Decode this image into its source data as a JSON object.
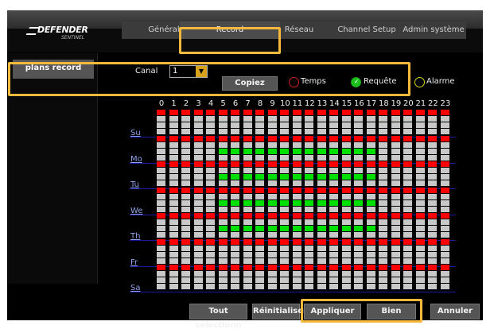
{
  "logo": {
    "brand": "DEFENDER",
    "sub": "SENTINEL"
  },
  "tabs": [
    {
      "label": "Général",
      "active": false
    },
    {
      "label": "Record",
      "active": true
    },
    {
      "label": "Réseau",
      "active": false
    },
    {
      "label": "Channel Setup",
      "active": false
    },
    {
      "label": "Admin système",
      "active": false
    }
  ],
  "sidebar": {
    "items": [
      {
        "label": "plans record"
      }
    ]
  },
  "controls": {
    "canal_label": "Canal",
    "canal_value": "1",
    "copy_label": "Copiez",
    "modes": [
      {
        "label": "Temps",
        "color": "#d01e1e",
        "selected": false
      },
      {
        "label": "Requête",
        "color": "#1ec01e",
        "selected": true
      },
      {
        "label": "Alarme",
        "color": "#d8d020",
        "selected": false
      }
    ]
  },
  "schedule": {
    "hours": [
      "0",
      "1",
      "2",
      "3",
      "4",
      "5",
      "6",
      "7",
      "8",
      "9",
      "10",
      "11",
      "12",
      "13",
      "14",
      "15",
      "16",
      "17",
      "18",
      "19",
      "20",
      "21",
      "22",
      "23"
    ],
    "days": [
      "Su",
      "Mo",
      "Tu",
      "We",
      "Th",
      "Fr",
      "Sa"
    ],
    "colors": {
      "time": "#ff0000",
      "empty": "#c8c8c8",
      "request": "#00e000"
    },
    "request_blocks": [
      {
        "day": "Mo",
        "from": 5,
        "to": 17
      },
      {
        "day": "Tu",
        "from": 5,
        "to": 17
      },
      {
        "day": "We",
        "from": 5,
        "to": 17
      },
      {
        "day": "Th",
        "from": 5,
        "to": 17
      }
    ]
  },
  "footer": {
    "select_all": "Tout sélectionn",
    "reset": "Réinitialiser",
    "apply": "Appliquer",
    "ok": "Bien",
    "cancel": "Annuler"
  }
}
